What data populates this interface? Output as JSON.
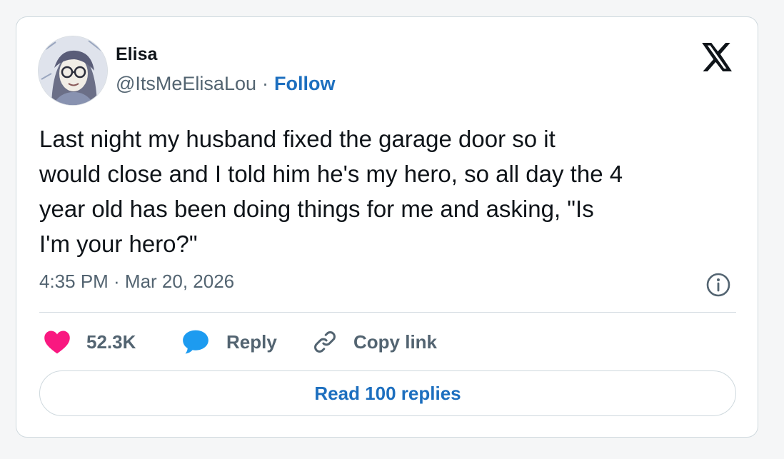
{
  "author": {
    "name": "Elisa",
    "handle": "@ItsMeElisaLou",
    "separator": "·",
    "follow_label": "Follow"
  },
  "tweet": {
    "text": "Last night my husband fixed the garage door so it\nwould close and I told him he's my hero, so all day the 4\nyear old has been doing things for me and asking, \"Is\nI'm your hero?\"",
    "timestamp": "4:35 PM · Mar 20, 2026"
  },
  "actions": {
    "like_count": "52.3K",
    "reply_label": "Reply",
    "copy_link_label": "Copy link",
    "read_replies_label": "Read 100 replies"
  },
  "icons": {
    "brand": "x-logo-icon",
    "info": "info-icon",
    "like": "heart-icon",
    "reply": "speech-bubble-icon",
    "copy": "link-icon"
  },
  "colors": {
    "like": "#f91880",
    "reply": "#1d9bf0",
    "link": "#1d6fbf",
    "text": "#0f1419",
    "muted": "#536471"
  }
}
